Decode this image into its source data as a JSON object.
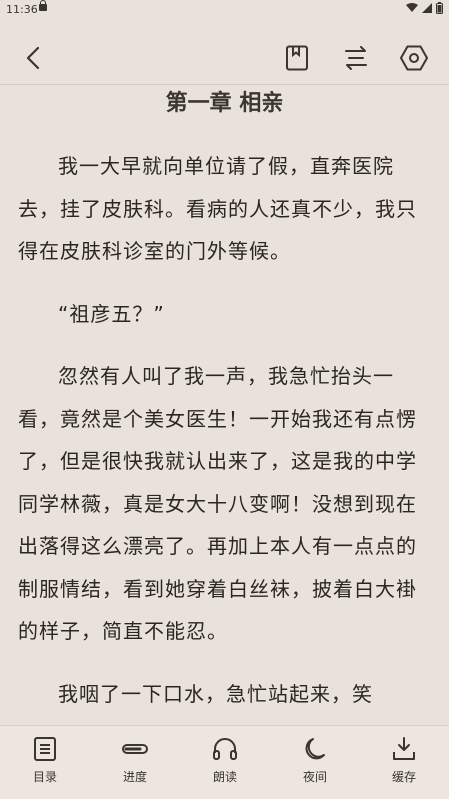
{
  "status_bar": {
    "time": "11:36",
    "lock_icon": "lock-icon",
    "wifi_icon": "wifi-icon",
    "signal_icon": "signal-icon",
    "battery_icon": "battery-icon"
  },
  "toolbar": {
    "back_icon": "back-icon",
    "bookmark_icon": "bookmark-icon",
    "switch_source_icon": "swap-icon",
    "settings_icon": "settings-icon"
  },
  "chapter": {
    "title": "第一章 相亲",
    "paragraphs": [
      "我一大早就向单位请了假，直奔医院去，挂了皮肤科。看病的人还真不少，我只得在皮肤科诊室的门外等候。",
      "“祖彦五？”",
      "忽然有人叫了我一声，我急忙抬头一看，竟然是个美女医生！一开始我还有点愣了，但是很快我就认出来了，这是我的中学同学林薇，真是女大十八变啊！没想到现在出落得这么漂亮了。再加上本人有一点点的制服情结，看到她穿着白丝袜，披着白大褂的样子，简直不能忍。",
      "我咽了一下口水，急忙站起来，笑"
    ]
  },
  "bottom_nav": {
    "items": [
      {
        "label": "目录",
        "icon": "list-icon"
      },
      {
        "label": "进度",
        "icon": "progress-icon"
      },
      {
        "label": "朗读",
        "icon": "headphones-icon"
      },
      {
        "label": "夜间",
        "icon": "moon-icon"
      },
      {
        "label": "缓存",
        "icon": "download-icon"
      }
    ]
  },
  "colors": {
    "background": "#e9e2da",
    "text": "#2b2622"
  }
}
